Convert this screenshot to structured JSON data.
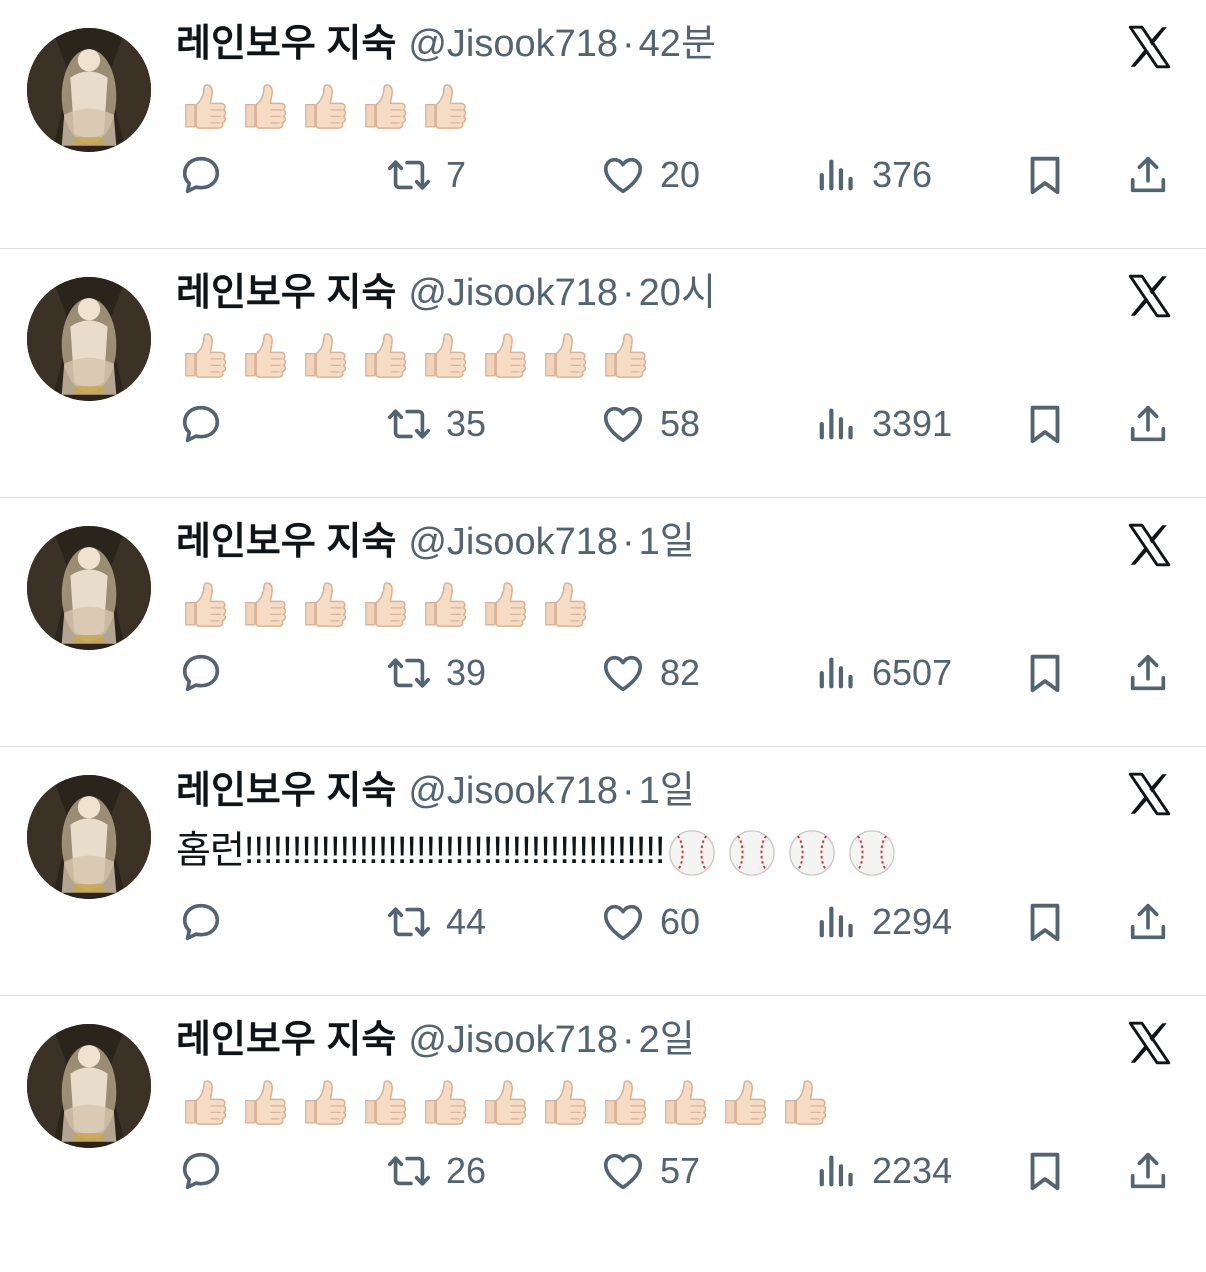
{
  "tweets": [
    {
      "name": "레인보우 지숙",
      "handle": "@Jisook718",
      "dot": "·",
      "time": "42분",
      "text": "",
      "emojis": [
        "thumbs-up",
        "thumbs-up",
        "thumbs-up",
        "thumbs-up",
        "thumbs-up"
      ],
      "retweets": "7",
      "likes": "20",
      "views": "376"
    },
    {
      "name": "레인보우 지숙",
      "handle": "@Jisook718",
      "dot": "·",
      "time": "20시",
      "text": "",
      "emojis": [
        "thumbs-up",
        "thumbs-up",
        "thumbs-up",
        "thumbs-up",
        "thumbs-up",
        "thumbs-up",
        "thumbs-up",
        "thumbs-up"
      ],
      "retweets": "35",
      "likes": "58",
      "views": "3391"
    },
    {
      "name": "레인보우 지숙",
      "handle": "@Jisook718",
      "dot": "·",
      "time": "1일",
      "text": "",
      "emojis": [
        "thumbs-up",
        "thumbs-up",
        "thumbs-up",
        "thumbs-up",
        "thumbs-up",
        "thumbs-up",
        "thumbs-up"
      ],
      "retweets": "39",
      "likes": "82",
      "views": "6507"
    },
    {
      "name": "레인보우 지숙",
      "handle": "@Jisook718",
      "dot": "·",
      "time": "1일",
      "text": "홈런!!!!!!!!!!!!!!!!!!!!!!!!!!!!!!!!!!!!!!!!!!!!",
      "emojis": [
        "baseball",
        "baseball",
        "baseball",
        "baseball"
      ],
      "retweets": "44",
      "likes": "60",
      "views": "2294"
    },
    {
      "name": "레인보우 지숙",
      "handle": "@Jisook718",
      "dot": "·",
      "time": "2일",
      "text": "",
      "emojis": [
        "thumbs-up",
        "thumbs-up",
        "thumbs-up",
        "thumbs-up",
        "thumbs-up",
        "thumbs-up",
        "thumbs-up",
        "thumbs-up",
        "thumbs-up",
        "thumbs-up",
        "thumbs-up"
      ],
      "retweets": "26",
      "likes": "57",
      "views": "2234"
    }
  ],
  "icons": {
    "reply": "reply-icon",
    "retweet": "retweet-icon",
    "like": "heart-icon",
    "views": "views-icon",
    "bookmark": "bookmark-icon",
    "share": "share-icon",
    "logo": "x-logo-icon"
  },
  "colors": {
    "text": "#0f1419",
    "muted": "#536471",
    "divider": "#dadde1",
    "skin": "#f6dcc4"
  }
}
